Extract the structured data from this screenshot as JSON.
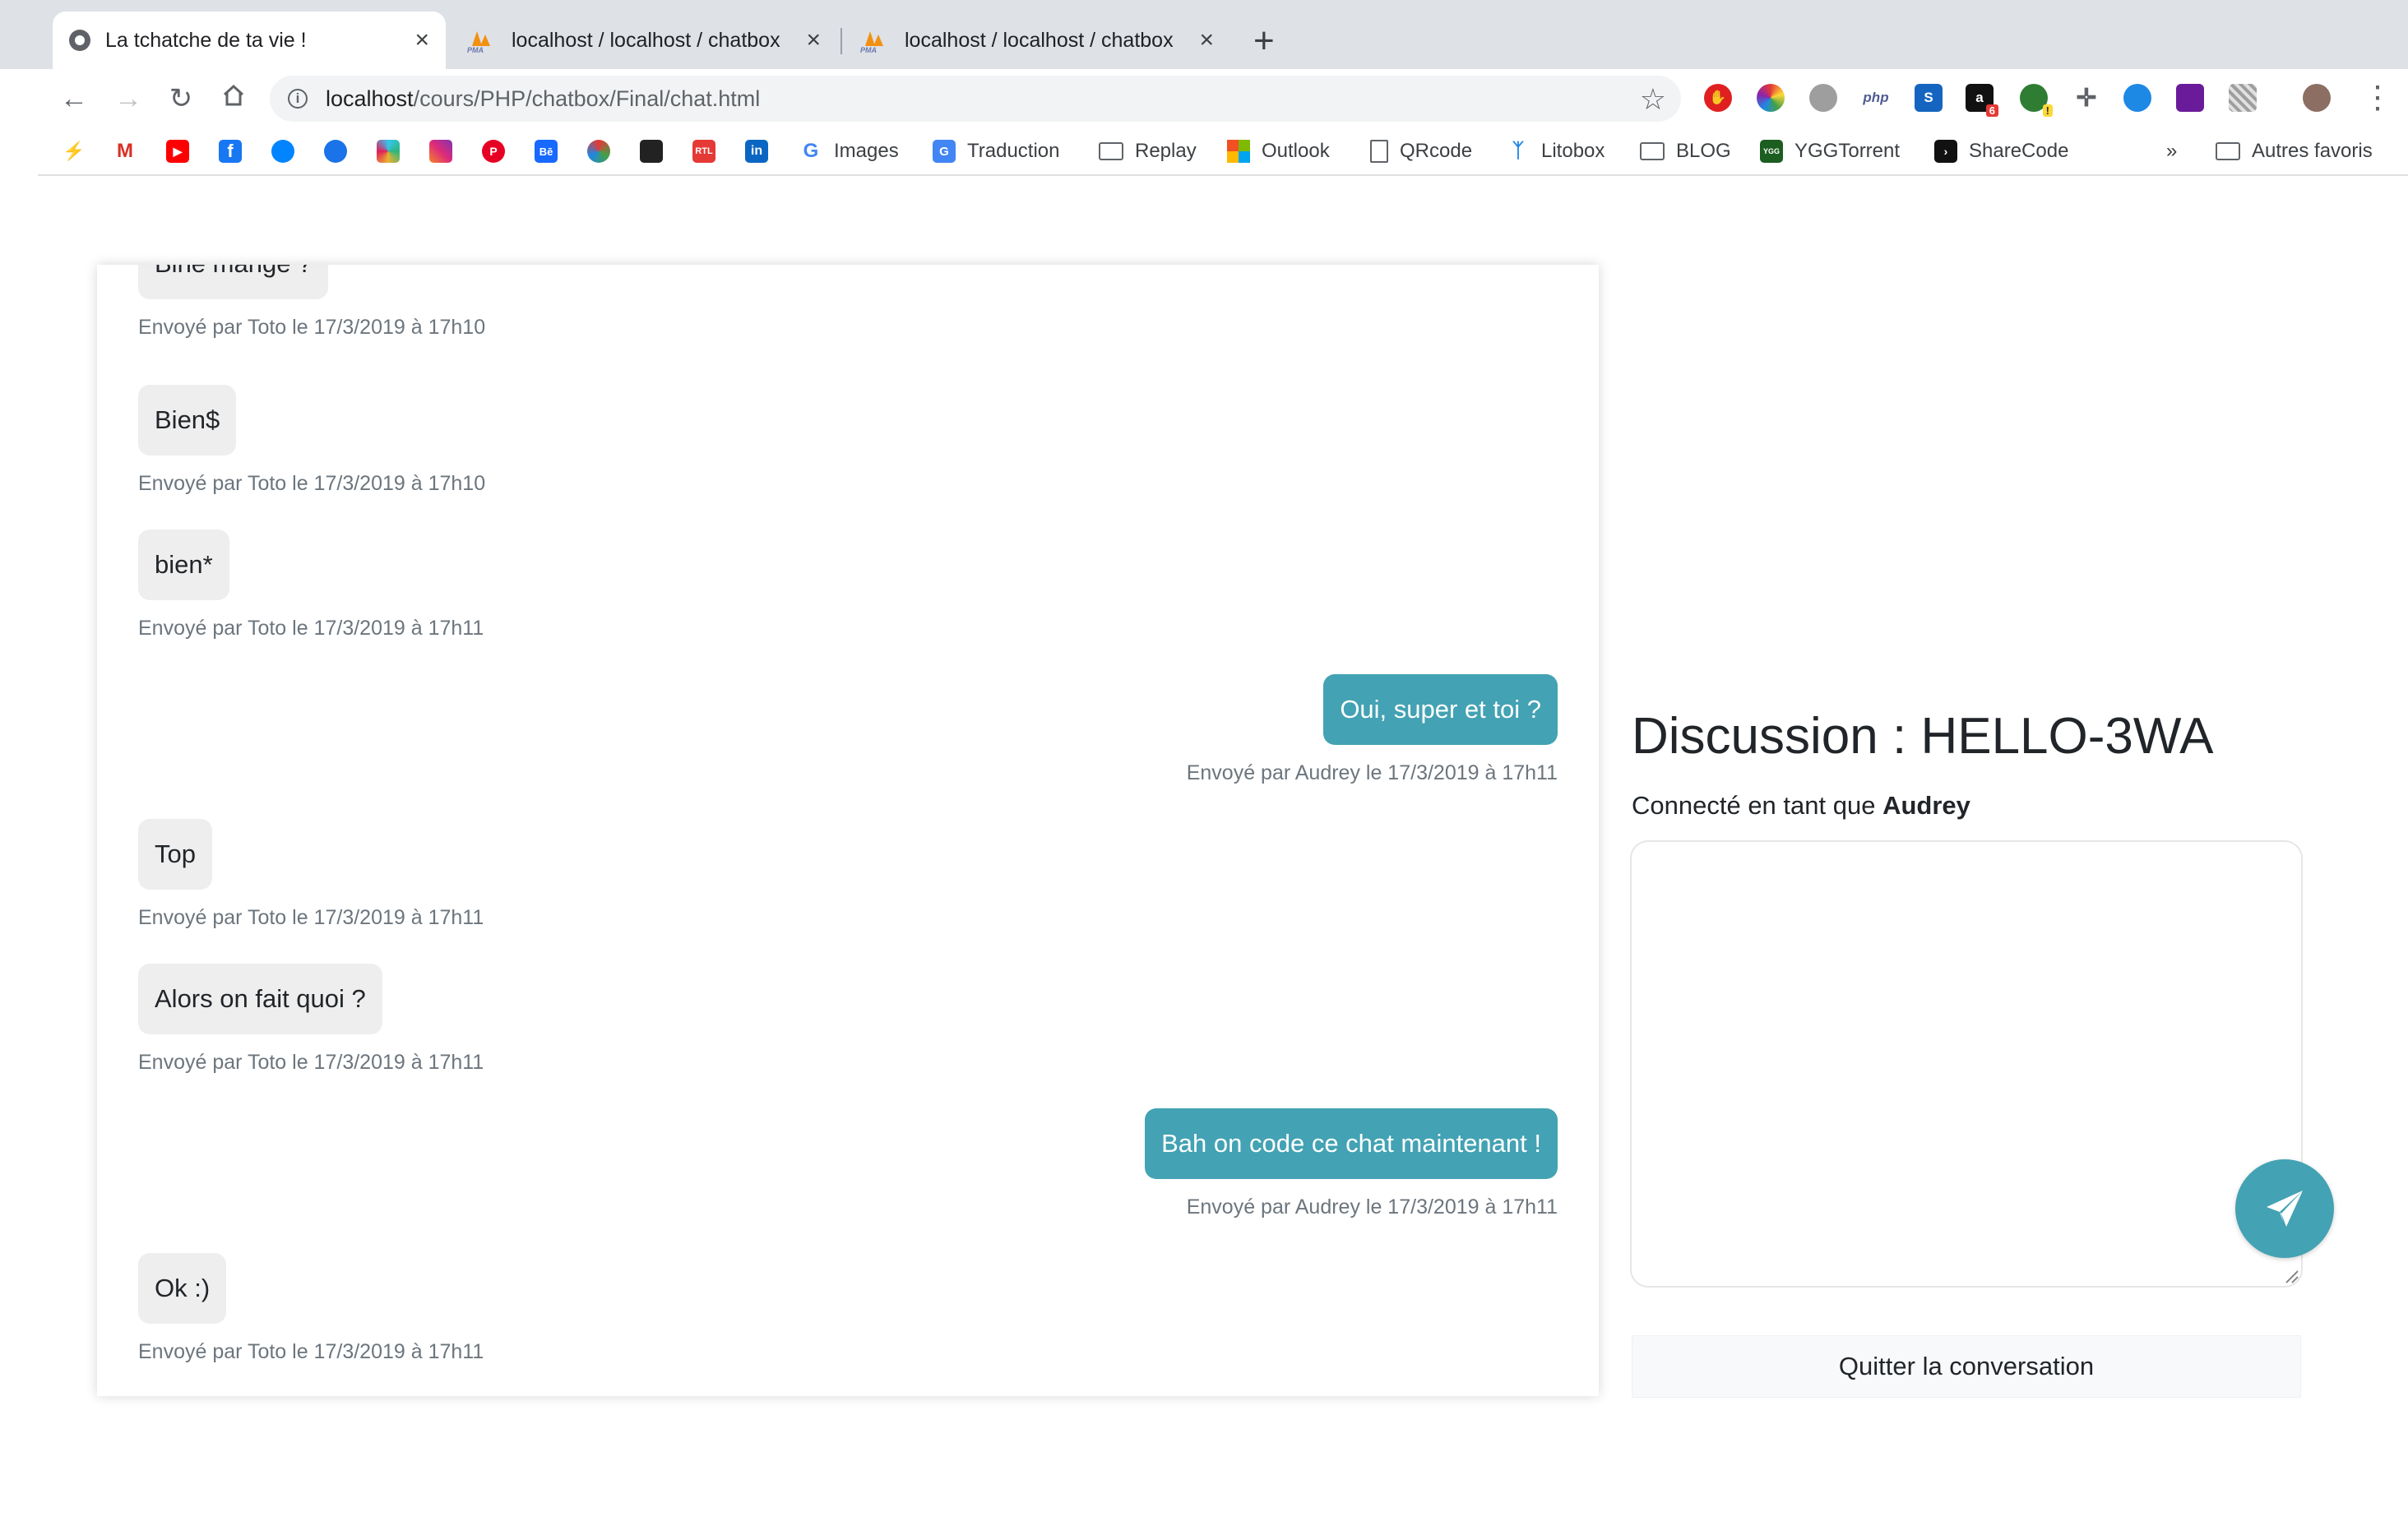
{
  "browser": {
    "tabs": [
      {
        "title": "La tchatche de ta vie !",
        "active": true,
        "icon": "github-icon"
      },
      {
        "title": "localhost / localhost / chatbox",
        "active": false,
        "icon": "phpmyadmin-icon"
      },
      {
        "title": "localhost / localhost / chatbox",
        "active": false,
        "icon": "phpmyadmin-icon"
      }
    ],
    "new_tab": "+",
    "url_host": "localhost",
    "url_path": "/cours/PHP/chatbox/Final/chat.html",
    "bookmarks": [
      {
        "label": "Images",
        "icon": "google-icon"
      },
      {
        "label": "Traduction",
        "icon": "translate-icon"
      },
      {
        "label": "Replay",
        "icon": "folder-icon"
      },
      {
        "label": "Outlook",
        "icon": "microsoft-icon"
      },
      {
        "label": "QRcode",
        "icon": "page-icon"
      },
      {
        "label": "Litobox",
        "icon": "litobox-icon"
      },
      {
        "label": "BLOG",
        "icon": "folder-icon"
      },
      {
        "label": "YGGTorrent",
        "icon": "ygg-icon"
      },
      {
        "label": "ShareCode",
        "icon": "sharecode-icon"
      }
    ],
    "overflow": "»",
    "other_bookmarks": "Autres favoris",
    "extension_badges": {
      "amazon": "6",
      "earth": "!"
    },
    "extension_labels": {
      "php": "php"
    },
    "colors": {
      "accent": "#43a2b3",
      "tabstrip": "#dee1e6"
    }
  },
  "chat": {
    "messages": [
      {
        "text": "Bine mangé ?",
        "meta": "Envoyé par Toto le 17/3/2019 à 17h10",
        "own": false
      },
      {
        "text": "Bien$",
        "meta": "Envoyé par Toto le 17/3/2019 à 17h10",
        "own": false
      },
      {
        "text": "bien*",
        "meta": "Envoyé par Toto le 17/3/2019 à 17h11",
        "own": false
      },
      {
        "text": "Oui, super et toi ?",
        "meta": "Envoyé par Audrey le 17/3/2019 à 17h11",
        "own": true
      },
      {
        "text": "Top",
        "meta": "Envoyé par Toto le 17/3/2019 à 17h11",
        "own": false
      },
      {
        "text": "Alors on fait quoi ?",
        "meta": "Envoyé par Toto le 17/3/2019 à 17h11",
        "own": false
      },
      {
        "text": "Bah on code ce chat maintenant !",
        "meta": "Envoyé par Audrey le 17/3/2019 à 17h11",
        "own": true
      },
      {
        "text": "Ok :)",
        "meta": "Envoyé par Toto le 17/3/2019 à 17h11",
        "own": false
      }
    ]
  },
  "sidebar": {
    "title": "Discussion : HELLO-3WA",
    "connected_prefix": "Connecté en tant que",
    "username": "Audrey",
    "message_value": "",
    "send_icon": "paper-plane-icon",
    "quit_label": "Quitter la conversation"
  }
}
